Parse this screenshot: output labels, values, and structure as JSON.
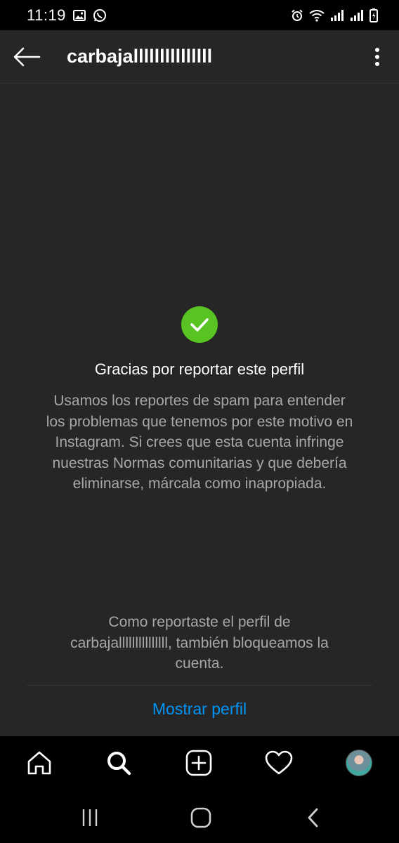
{
  "status_bar": {
    "time": "11:19",
    "left_icons": [
      "image-icon",
      "whatsapp-icon"
    ],
    "right_icons": [
      "alarm-icon",
      "wifi-icon",
      "signal-icon",
      "signal-icon",
      "battery-charging-icon"
    ]
  },
  "header": {
    "back_icon": "back-arrow-icon",
    "title": "carbajalllllllllllllll",
    "more_icon": "more-vertical-icon"
  },
  "main": {
    "status_icon": "check-circle-icon",
    "confirmation_title": "Gracias por reportar este perfil",
    "confirmation_body": "Usamos los reportes de spam para entender los problemas que tenemos por este motivo en Instagram. Si crees que esta cuenta infringe nuestras Normas comunitarias y que debería eliminarse, márcala como inapropiada.",
    "block_note": "Como reportaste el perfil de carbajalllllllllllllll, también bloqueamos la cuenta.",
    "show_profile_label": "Mostrar perfil"
  },
  "bottom_nav": {
    "items": [
      "home-icon",
      "search-icon",
      "new-post-icon",
      "activity-heart-icon",
      "profile-avatar"
    ]
  },
  "system_nav": {
    "items": [
      "recent-apps-icon",
      "home-button-icon",
      "back-icon"
    ]
  },
  "colors": {
    "background": "#262626",
    "bars": "#000000",
    "success_green": "#58c322",
    "link_blue": "#0095f6",
    "secondary_text": "#a8a8a8"
  }
}
